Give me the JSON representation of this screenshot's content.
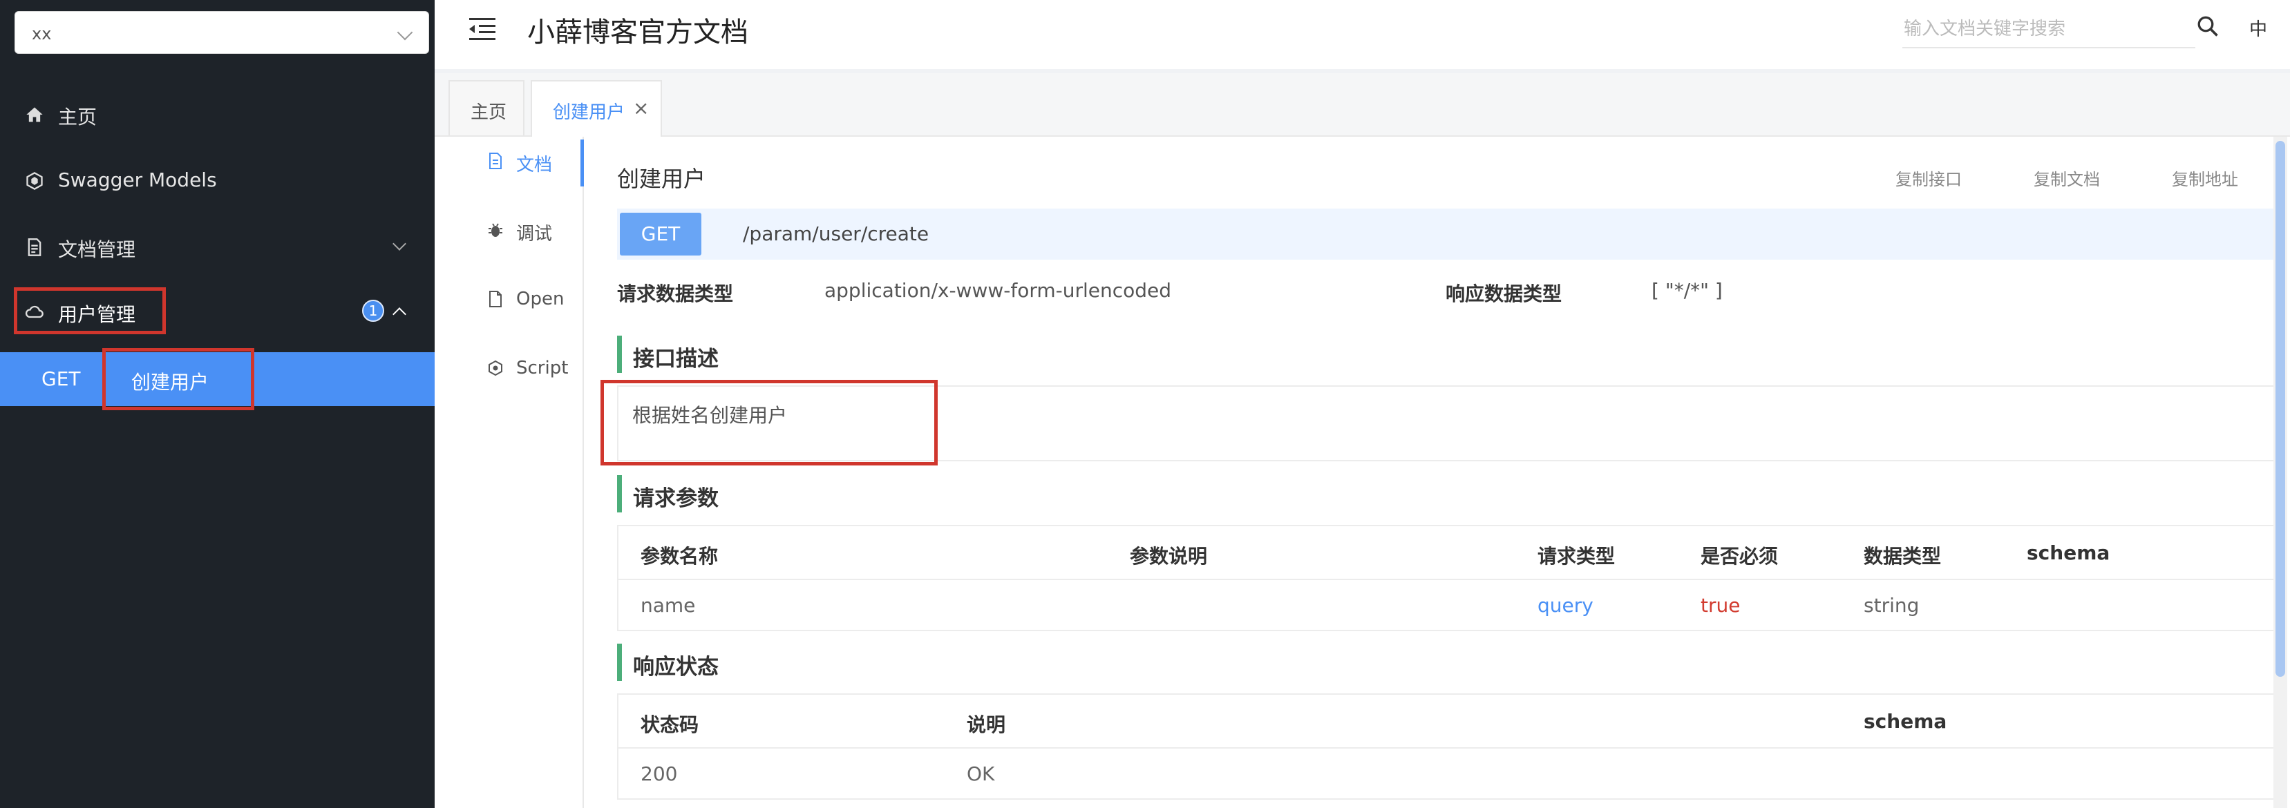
{
  "sidebar": {
    "group_select": {
      "value": "xx",
      "icon": "chevron-down-icon"
    },
    "items": [
      {
        "label": "主页",
        "icon": "home-icon"
      },
      {
        "label": "Swagger Models",
        "icon": "models-icon"
      },
      {
        "label": "文档管理",
        "icon": "document-manage-icon"
      },
      {
        "label": "用户管理",
        "icon": "cloud-icon",
        "badge": "1"
      }
    ],
    "sub_item": {
      "method": "GET",
      "label": "创建用户"
    }
  },
  "header": {
    "title": "小薛博客官方文档",
    "search_placeholder": "输入文档关键字搜索",
    "lang": "中"
  },
  "tabs": [
    {
      "label": "主页"
    },
    {
      "label": "创建用户",
      "active": true
    }
  ],
  "modes": [
    {
      "label": "文档",
      "icon": "document-icon",
      "active": true
    },
    {
      "label": "调试",
      "icon": "bug-icon"
    },
    {
      "label": "Open",
      "icon": "file-icon"
    },
    {
      "label": "Script",
      "icon": "script-icon"
    }
  ],
  "doc": {
    "title": "创建用户",
    "actions": [
      "复制接口",
      "复制文档",
      "复制地址"
    ],
    "method": "GET",
    "path": "/param/user/create",
    "request_type_label": "请求数据类型",
    "request_type": "application/x-www-form-urlencoded",
    "response_type_label": "响应数据类型",
    "response_type": "[ \"*/*\" ]",
    "desc_heading": "接口描述",
    "desc": "根据姓名创建用户",
    "params_heading": "请求参数",
    "params_columns": [
      "参数名称",
      "参数说明",
      "请求类型",
      "是否必须",
      "数据类型",
      "schema"
    ],
    "params_rows": [
      {
        "name": "name",
        "desc": "",
        "in": "query",
        "required": "true",
        "type": "string",
        "schema": ""
      }
    ],
    "status_heading": "响应状态",
    "status_columns": [
      "状态码",
      "说明",
      "schema"
    ],
    "status_rows": [
      {
        "code": "200",
        "desc": "OK",
        "schema": ""
      }
    ]
  },
  "colors": {
    "sidebar_bg": "#1e2329",
    "accent": "#4a90f5",
    "highlight_box": "#d0362d",
    "section_bar": "#4cae7a",
    "required": "#d23b2f"
  }
}
